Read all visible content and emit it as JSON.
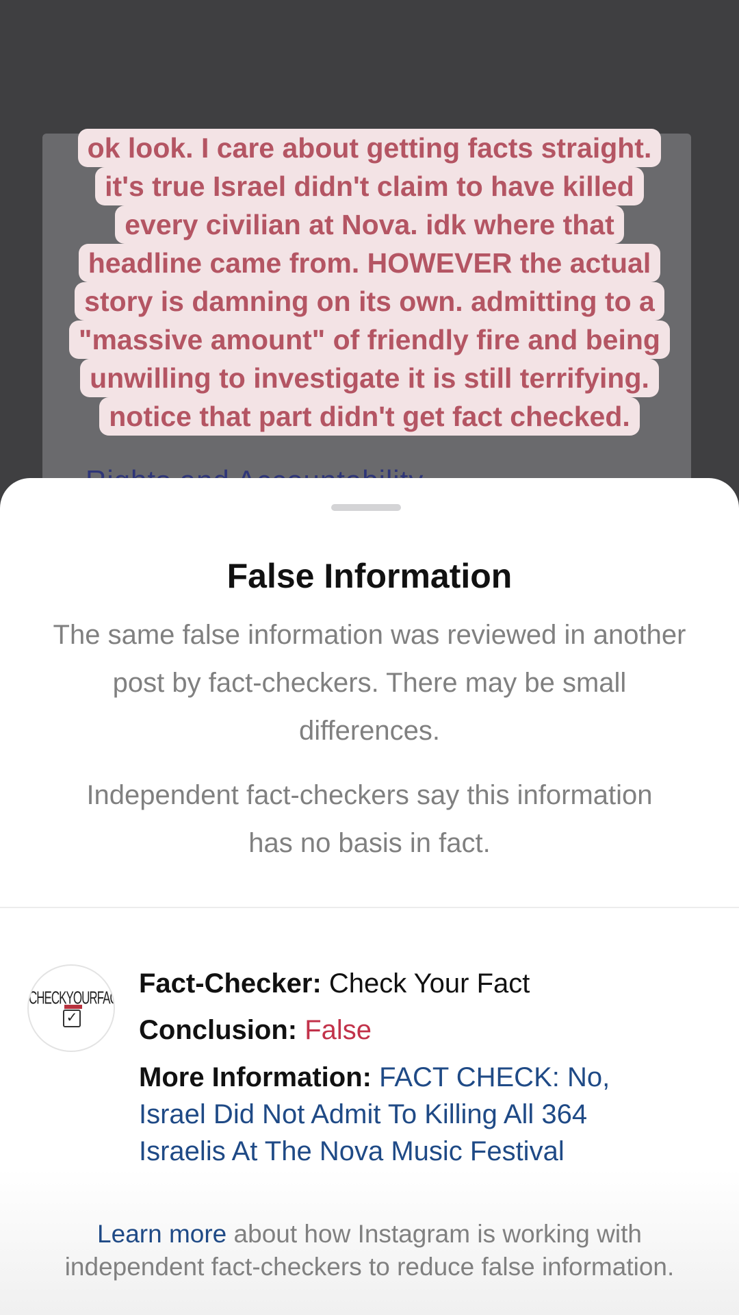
{
  "background": {
    "partial_text": "Rights and Accountability"
  },
  "caption": {
    "lines": [
      "ok look. I care about getting facts straight.",
      "it's true Israel didn't claim to have killed",
      "every civilian at Nova. idk where that",
      "headline came from. HOWEVER the actual",
      "story is damning on its own. admitting to a",
      "\"massive amount\" of friendly fire and being",
      "unwilling to investigate it is still terrifying.",
      "notice that part didn't get fact checked."
    ]
  },
  "sheet": {
    "title": "False Information",
    "subtitle": "The same false information was reviewed in another post by fact-checkers. There may be small differences.",
    "verdict_text": "Independent fact-checkers say this information has no basis in fact.",
    "fact_check": {
      "logo_text": "CHECKYOURFACT",
      "fact_checker_label": "Fact-Checker:",
      "fact_checker_value": "Check Your Fact",
      "conclusion_label": "Conclusion:",
      "conclusion_value": "False",
      "more_info_label": "More Information:",
      "more_info_link_line1": "FACT CHECK: No,",
      "more_info_link_line2": "Israel Did Not Admit To Killing All 364",
      "more_info_link_line3": "Israelis At The Nova Music Festival"
    },
    "footer": {
      "learn_more_link": "Learn more",
      "footer_text": " about how Instagram is working with independent fact-checkers to reduce false information."
    }
  },
  "colors": {
    "caption_bg": "#f3e3e5",
    "caption_text": "#b45563",
    "false_red": "#c2324a",
    "link_blue": "#1f4a86"
  }
}
